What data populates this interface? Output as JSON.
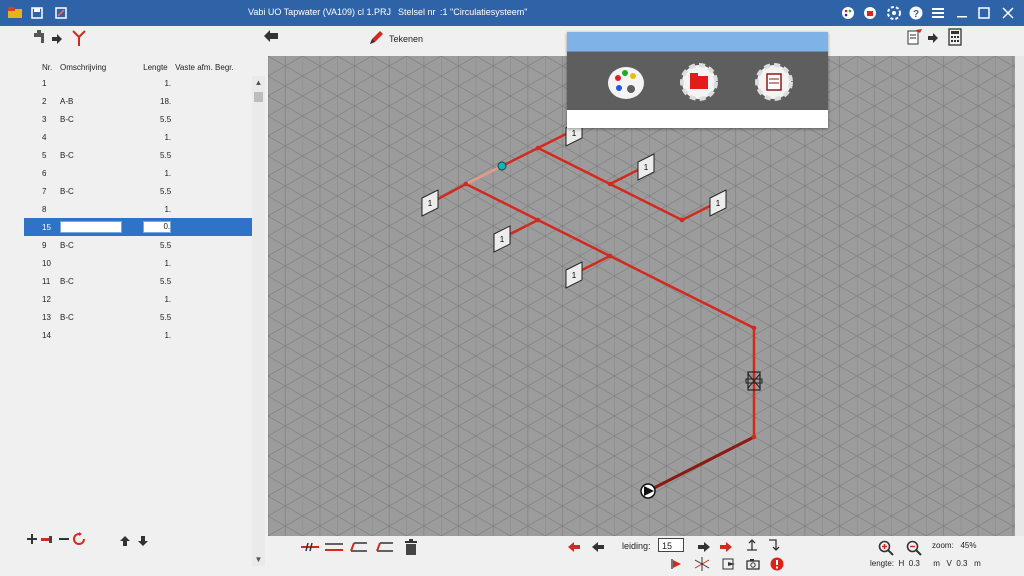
{
  "window": {
    "title": "Vabi UO Tapwater (VA109)  cl 1.PRJ",
    "stelsel_label": "Stelsel nr",
    "stelsel_value": ":1  \"Circulatiesysteem\""
  },
  "toolbar": {
    "teken_label": "Tekenen"
  },
  "table": {
    "headers": [
      "Nr.",
      "Omschrijving",
      "Lengte",
      "Vaste afm.",
      "Begr."
    ],
    "rows": [
      {
        "nr": "1",
        "omschrijving": "",
        "lengte": "1."
      },
      {
        "nr": "2",
        "omschrijving": "A-B",
        "lengte": "18."
      },
      {
        "nr": "3",
        "omschrijving": "B-C",
        "lengte": "5.5"
      },
      {
        "nr": "4",
        "omschrijving": "",
        "lengte": "1."
      },
      {
        "nr": "5",
        "omschrijving": "B-C",
        "lengte": "5.5"
      },
      {
        "nr": "6",
        "omschrijving": "",
        "lengte": "1."
      },
      {
        "nr": "7",
        "omschrijving": "B-C",
        "lengte": "5.5"
      },
      {
        "nr": "8",
        "omschrijving": "",
        "lengte": "1."
      },
      {
        "nr": "15",
        "omschrijving": "",
        "lengte": "0.",
        "selected": true
      },
      {
        "nr": "9",
        "omschrijving": "B-C",
        "lengte": "5.5"
      },
      {
        "nr": "10",
        "omschrijving": "",
        "lengte": "1."
      },
      {
        "nr": "11",
        "omschrijving": "B-C",
        "lengte": "5.5"
      },
      {
        "nr": "12",
        "omschrijving": "",
        "lengte": "1."
      },
      {
        "nr": "13",
        "omschrijving": "B-C",
        "lengte": "5.5"
      },
      {
        "nr": "14",
        "omschrijving": "",
        "lengte": "1."
      }
    ]
  },
  "drawing": {
    "tap_label": "1"
  },
  "bottom": {
    "leiding_label": "leiding:",
    "leiding_value": "15",
    "zoom_label": "zoom:",
    "zoom_value": "45%",
    "lengte_label": "lengte:",
    "h_label": "H",
    "h_value": "0.3",
    "m1": "m",
    "v_label": "V",
    "v_value": "0.3",
    "m2": "m"
  },
  "colors": {
    "accent": "#2e63a8",
    "pipe": "#d22a1f",
    "selection": "#2f73c9"
  },
  "icons": {
    "palette": "palette-icon",
    "folder_gear": "folder-gear-icon",
    "settings": "settings-icon"
  }
}
